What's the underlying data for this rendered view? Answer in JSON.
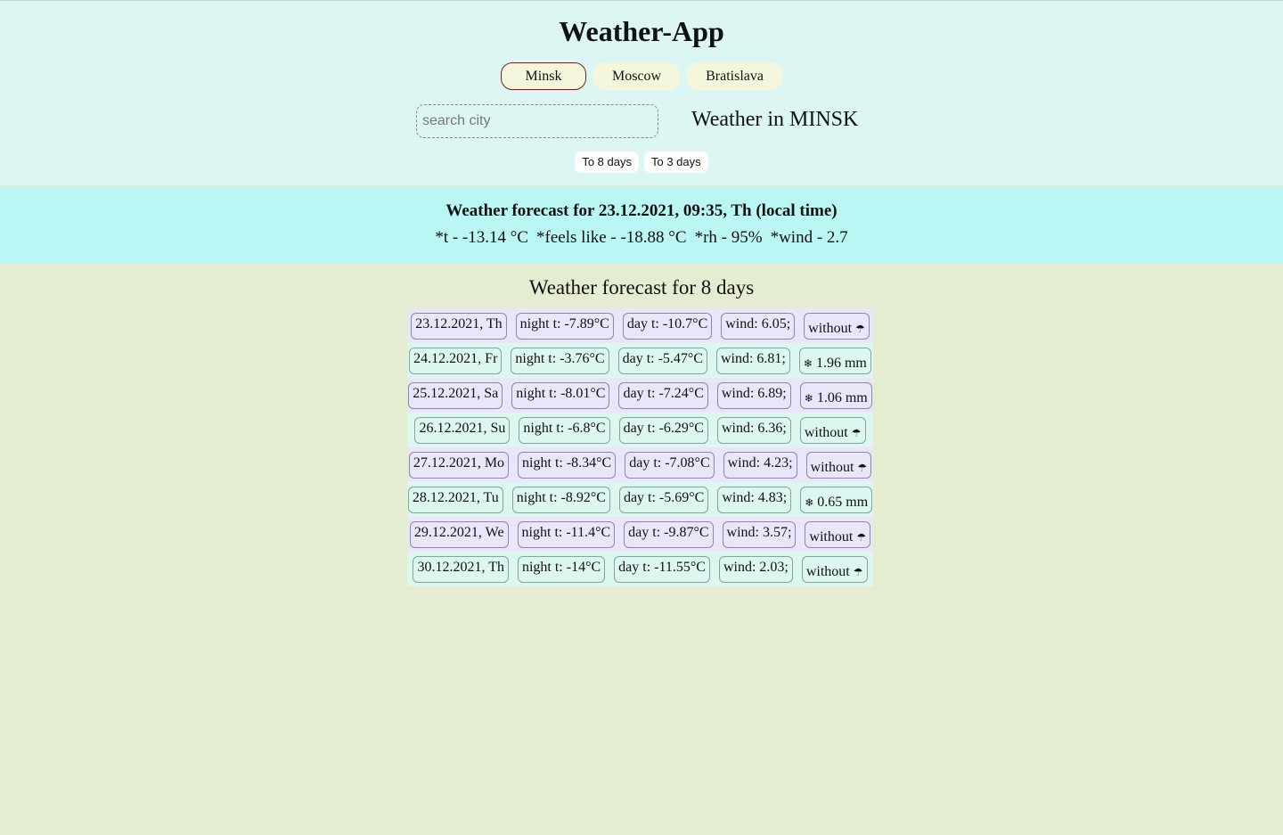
{
  "app": {
    "title": "Weather-App"
  },
  "cities": {
    "items": [
      "Minsk",
      "Moscow",
      "Bratislava"
    ],
    "active": "Minsk"
  },
  "search": {
    "placeholder": "search city",
    "value": ""
  },
  "weather_in": "Weather in MINSK",
  "ranges": {
    "to8": "To 8 days",
    "to3": "To 3 days"
  },
  "current": {
    "title": "Weather forecast for 23.12.2021, 09:35, Th (local time)",
    "temp": "*t - -13.14 °C",
    "feels_like": "*feels like - -18.88 °C",
    "rh": "*rh - 95%",
    "wind": "*wind - 2.7"
  },
  "forecast": {
    "title": "Weather forecast for 8 days",
    "icons": {
      "no_rain": "umbrella-icon",
      "snow": "snowflake-icon"
    },
    "days": [
      {
        "date": "23.12.2021, Th",
        "night": "night t: -7.89°C",
        "day": "day t: -10.7°C",
        "wind": "wind: 6.05;",
        "precip": "without",
        "precip_icon": "☂"
      },
      {
        "date": "24.12.2021, Fr",
        "night": "night t: -3.76°C",
        "day": "day t: -5.47°C",
        "wind": "wind: 6.81;",
        "precip": "1.96 mm",
        "precip_icon": "❄"
      },
      {
        "date": "25.12.2021, Sa",
        "night": "night t: -8.01°C",
        "day": "day t: -7.24°C",
        "wind": "wind: 6.89;",
        "precip": "1.06 mm",
        "precip_icon": "❄"
      },
      {
        "date": "26.12.2021, Su",
        "night": "night t: -6.8°C",
        "day": "day t: -6.29°C",
        "wind": "wind: 6.36;",
        "precip": "without",
        "precip_icon": "☂"
      },
      {
        "date": "27.12.2021, Mo",
        "night": "night t: -8.34°C",
        "day": "day t: -7.08°C",
        "wind": "wind: 4.23;",
        "precip": "without",
        "precip_icon": "☂"
      },
      {
        "date": "28.12.2021, Tu",
        "night": "night t: -8.92°C",
        "day": "day t: -5.69°C",
        "wind": "wind: 4.83;",
        "precip": "0.65 mm",
        "precip_icon": "❄"
      },
      {
        "date": "29.12.2021, We",
        "night": "night t: -11.4°C",
        "day": "day t: -9.87°C",
        "wind": "wind: 3.57;",
        "precip": "without",
        "precip_icon": "☂"
      },
      {
        "date": "30.12.2021, Th",
        "night": "night t: -14°C",
        "day": "day t: -11.55°C",
        "wind": "wind: 2.03;",
        "precip": "without",
        "precip_icon": "☂"
      }
    ]
  }
}
